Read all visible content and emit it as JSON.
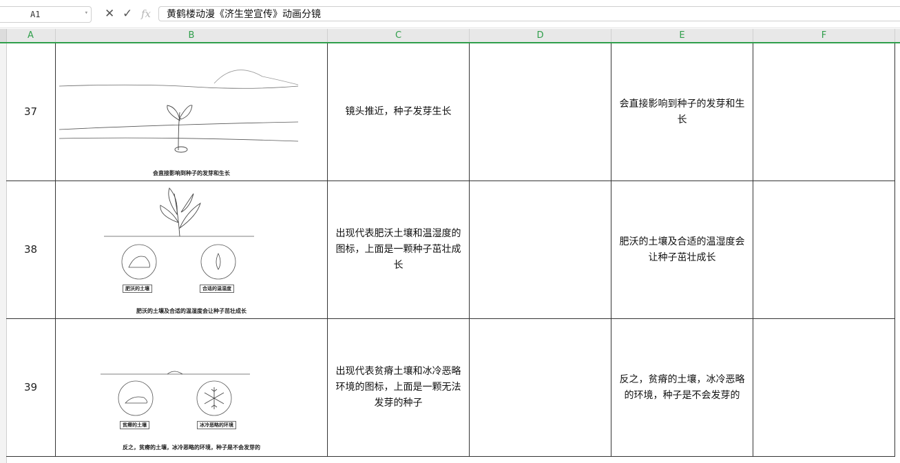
{
  "formula_bar": {
    "cell_ref": "A1",
    "formula_text": "黄鹤楼动漫《济生堂宣传》动画分镜"
  },
  "icons": {
    "namebox_dropdown": "chevron-down-icon",
    "cancel": "close-icon",
    "confirm": "check-icon",
    "function": "fx-icon"
  },
  "columns": [
    "A",
    "B",
    "C",
    "D",
    "E",
    "F"
  ],
  "rows": [
    {
      "num": "37",
      "image_caption": "会直接影响到种子的发芽和生长",
      "image_labels": [],
      "description": "镜头推近，种子发芽生长",
      "d": "",
      "narration": "会直接影响到种子的发芽和生长",
      "f": ""
    },
    {
      "num": "38",
      "image_caption": "肥沃的土壤及合适的温湿度会让种子茁壮成长",
      "image_labels": [
        "肥沃的土壤",
        "合适的温湿度"
      ],
      "description": "出现代表肥沃土壤和温湿度的图标，上面是一颗种子茁壮成长",
      "d": "",
      "narration": "肥沃的土壤及合适的温湿度会让种子茁壮成长",
      "f": ""
    },
    {
      "num": "39",
      "image_caption": "反之，贫瘠的土壤，冰冷恶略的环境，种子是不会发芽的",
      "image_labels": [
        "贫瘠的土壤",
        "冰冷恶略的环境"
      ],
      "description": "出现代表贫瘠土壤和冰冷恶略环境的图标，上面是一颗无法发芽的种子",
      "d": "",
      "narration": "反之，贫瘠的土壤，冰冷恶略的环境，种子是不会发芽的",
      "f": ""
    }
  ],
  "colors": {
    "header_accent": "#2e9e4a",
    "grid_line": "#333333"
  }
}
